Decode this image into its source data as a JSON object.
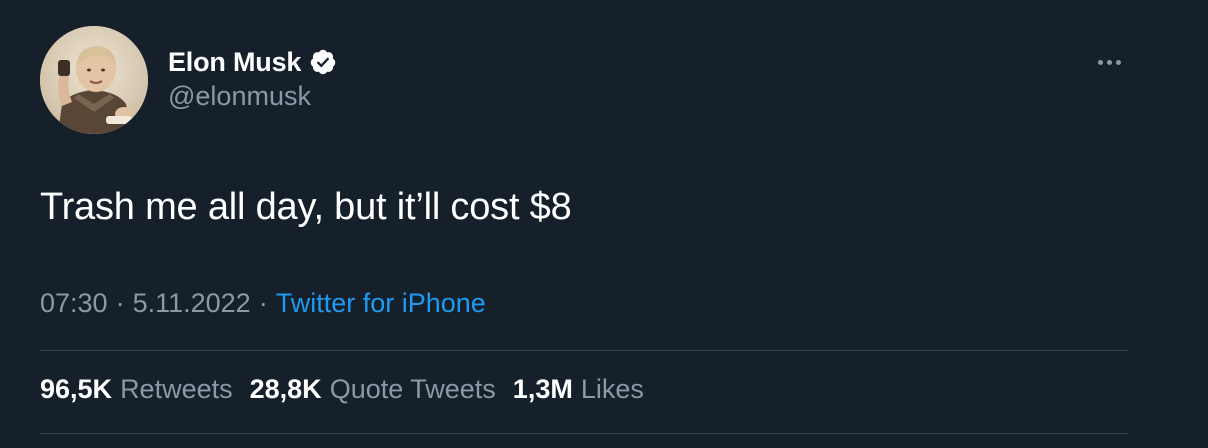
{
  "user": {
    "display_name": "Elon Musk",
    "handle": "@elonmusk",
    "verified_icon": "verified-badge-icon",
    "avatar_icon": "profile-photo"
  },
  "tweet": {
    "text": "Trash me all day, but it’ll cost $8"
  },
  "meta": {
    "time": "07:30",
    "separator": "·",
    "date": "5.11.2022",
    "source": "Twitter for iPhone"
  },
  "stats": [
    {
      "value": "96,5K",
      "label": "Retweets"
    },
    {
      "value": "28,8K",
      "label": "Quote Tweets"
    },
    {
      "value": "1,3M",
      "label": "Likes"
    }
  ],
  "colors": {
    "background": "#15202b",
    "primary_text": "#ffffff",
    "secondary_text": "#8b98a5",
    "link": "#1d9bf0",
    "divider": "#38444d"
  },
  "more_icon": "more-horizontal-icon"
}
